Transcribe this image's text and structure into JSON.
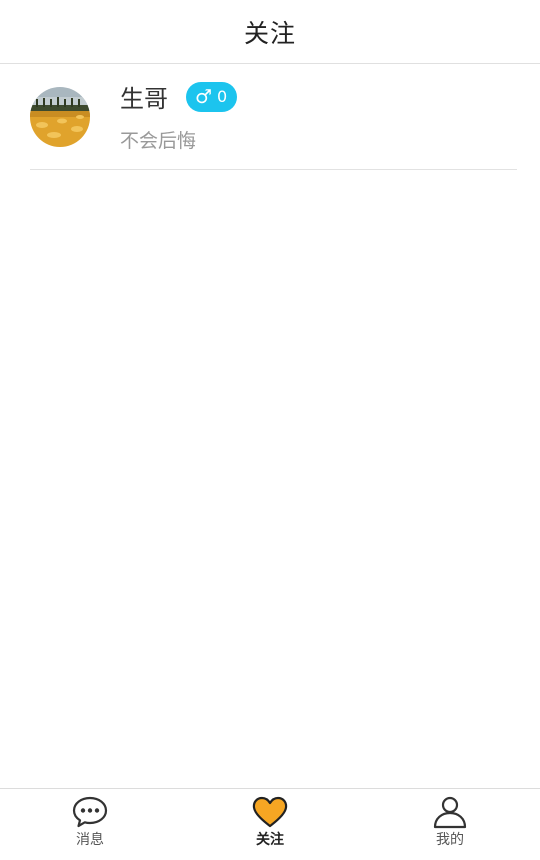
{
  "header": {
    "title": "关注"
  },
  "follow_list": [
    {
      "avatar": "landscape-photo",
      "name": "生哥",
      "gender_symbol": "♂",
      "gender_count": "0",
      "signature": "不会后悔"
    }
  ],
  "tabbar": {
    "tabs": [
      {
        "label": "消息",
        "icon": "chat-bubble-icon",
        "active": false
      },
      {
        "label": "关注",
        "icon": "heart-icon",
        "active": true
      },
      {
        "label": "我的",
        "icon": "person-icon",
        "active": false
      }
    ]
  },
  "colors": {
    "badge": "#1cc4ee",
    "active_heart": "#f6a623",
    "divider": "#e2e2e2"
  }
}
